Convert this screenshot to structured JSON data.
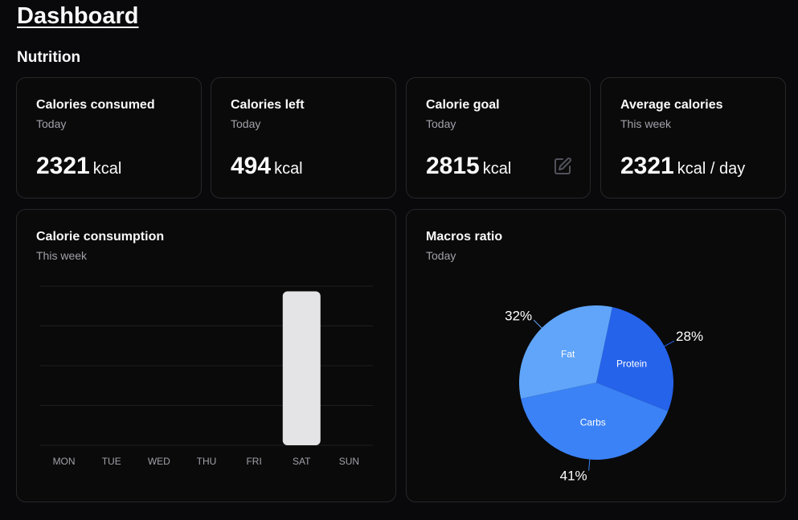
{
  "page": {
    "title": "Dashboard",
    "section": "Nutrition"
  },
  "stats": [
    {
      "title": "Calories consumed",
      "period": "Today",
      "value": "2321",
      "unit": "kcal"
    },
    {
      "title": "Calories left",
      "period": "Today",
      "value": "494",
      "unit": "kcal"
    },
    {
      "title": "Calorie goal",
      "period": "Today",
      "value": "2815",
      "unit": "kcal",
      "action_icon": "edit-icon"
    },
    {
      "title": "Average calories",
      "period": "This week",
      "value": "2321",
      "unit": "kcal / day"
    }
  ],
  "consumption_card": {
    "title": "Calorie consumption",
    "period": "This week"
  },
  "macros_card": {
    "title": "Macros ratio",
    "period": "Today"
  },
  "colors": {
    "background": "#09090b",
    "card_border": "#27272a",
    "bar": "#e4e4e7",
    "protein": "#2563eb",
    "fat": "#60a5fa",
    "carbs": "#3b82f6"
  },
  "chart_data": [
    {
      "type": "bar",
      "categories": [
        "MON",
        "TUE",
        "WED",
        "THU",
        "FRI",
        "SAT",
        "SUN"
      ],
      "values": [
        0,
        0,
        0,
        0,
        0,
        2321,
        0
      ],
      "ylim": [
        0,
        2400
      ],
      "grid": true,
      "legend": "none"
    },
    {
      "type": "pie",
      "labels": [
        "Protein",
        "Carbs",
        "Fat"
      ],
      "values": [
        28,
        41,
        32
      ],
      "percent_labels": [
        "28%",
        "41%",
        "32%"
      ],
      "legend": "none"
    }
  ]
}
